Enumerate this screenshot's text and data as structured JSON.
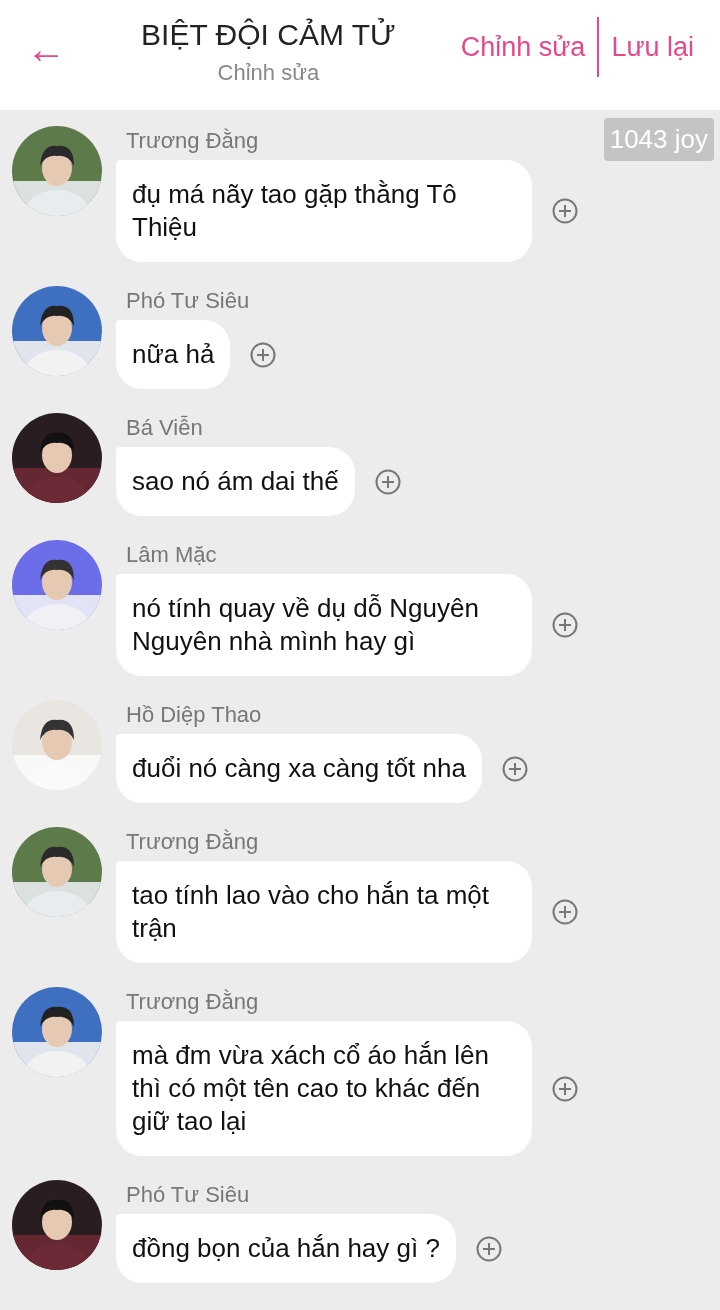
{
  "header": {
    "back_icon": "←",
    "title": "BIỆT ĐỘI CẢM TỬ",
    "subtitle": "Chỉnh sửa",
    "actions": [
      "Chỉnh sửa",
      "Lưu lại"
    ]
  },
  "badge": "1043 joy",
  "messages": [
    {
      "sender": "Trương Đằng",
      "text": "đụ má nãy tao gặp thằng Tô Thiệu"
    },
    {
      "sender": "Phó Tư Siêu",
      "text": "nữa hả"
    },
    {
      "sender": "Bá Viễn",
      "text": "sao nó ám dai thế"
    },
    {
      "sender": "Lâm Mặc",
      "text": "nó tính quay về dụ dỗ Nguyên Nguyên nhà mình hay gì"
    },
    {
      "sender": "Hồ Diệp Thao",
      "text": "đuổi nó càng xa càng tốt nha"
    },
    {
      "sender": "Trương Đằng",
      "text": "tao tính lao vào cho hắn ta một trận"
    },
    {
      "sender": "Trương Đằng",
      "text": "mà đm vừa xách cổ áo hắn lên thì có một tên cao to khác đến giữ tao lại"
    },
    {
      "sender": "Phó Tư Siêu",
      "text": "đồng bọn của hắn hay gì ?"
    }
  ]
}
